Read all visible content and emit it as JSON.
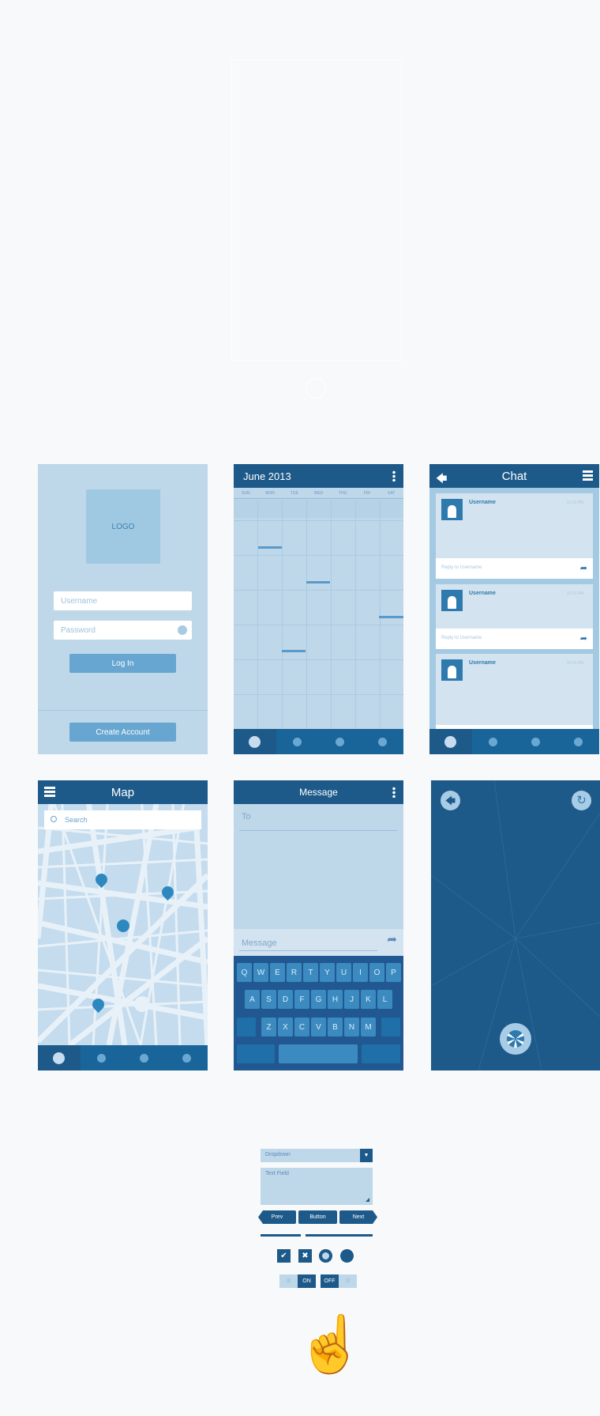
{
  "login": {
    "logo": "LOGO",
    "username_placeholder": "Username",
    "password_placeholder": "Password",
    "login_label": "Log In",
    "create_account_label": "Create Account"
  },
  "calendar": {
    "title": "June 2013",
    "days": [
      "SUN",
      "MON",
      "TUE",
      "WED",
      "THU",
      "FRI",
      "SAT"
    ]
  },
  "chat": {
    "title": "Chat",
    "messages": [
      {
        "username": "Username",
        "time": "12:15 PM",
        "reply_placeholder": "Reply to Username"
      },
      {
        "username": "Username",
        "time": "12:15 PM",
        "reply_placeholder": "Reply to Username"
      },
      {
        "username": "Username",
        "time": "12:15 PM"
      }
    ]
  },
  "map": {
    "title": "Map",
    "search_placeholder": "Search"
  },
  "message": {
    "title": "Message",
    "to_label": "To",
    "message_placeholder": "Message",
    "keyboard": {
      "row1": [
        "Q",
        "W",
        "E",
        "R",
        "T",
        "Y",
        "U",
        "I",
        "O",
        "P"
      ],
      "row2": [
        "A",
        "S",
        "D",
        "F",
        "G",
        "H",
        "J",
        "K",
        "L"
      ],
      "row3": [
        "Z",
        "X",
        "C",
        "V",
        "B",
        "N",
        "M"
      ]
    }
  },
  "widgets": {
    "dropdown_label": "Dropdown",
    "text_field_label": "Text Field",
    "prev_label": "Prev",
    "button_label": "Button",
    "next_label": "Next",
    "slider_value": 0.38,
    "toggle_on_label": "ON",
    "toggle_off_label": "OFF"
  },
  "colors": {
    "dark": "#1d5a8a",
    "light": "#bed7e9",
    "accent": "#66a6d0"
  }
}
